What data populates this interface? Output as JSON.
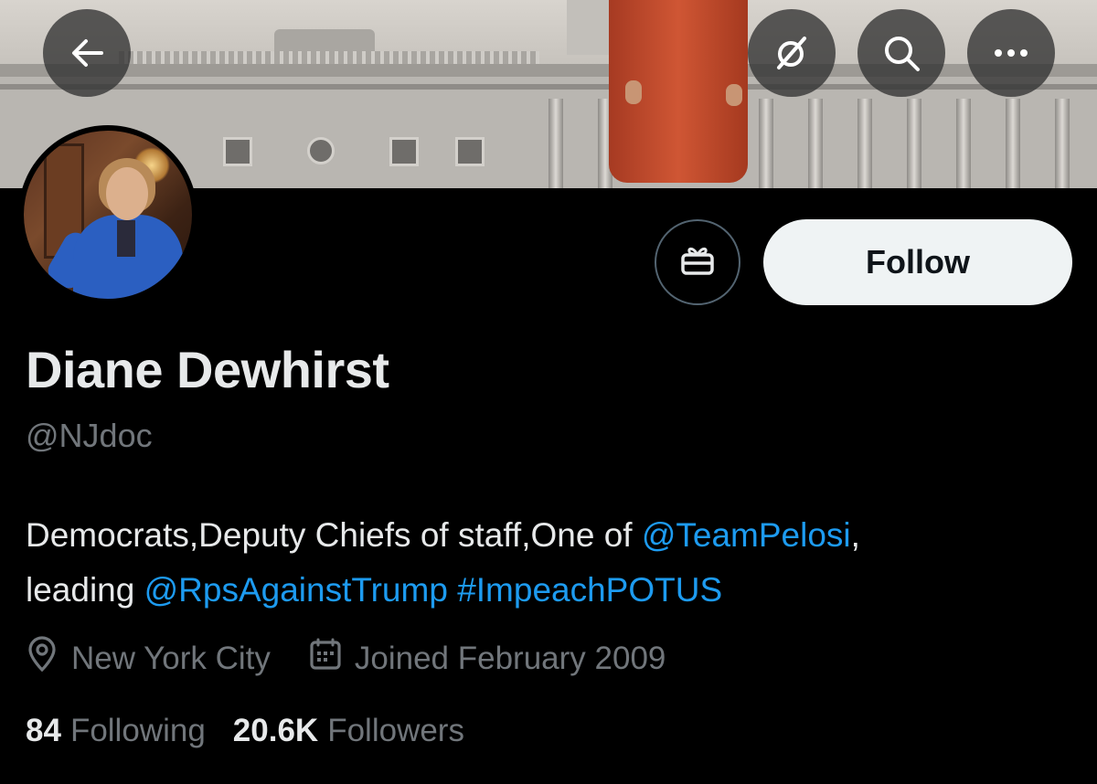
{
  "header": {
    "back_icon": "arrow-left-icon",
    "grok_icon": "grok-icon",
    "search_icon": "search-icon",
    "more_icon": "more-horizontal-icon"
  },
  "profile": {
    "name": "Diane Dewhirst",
    "handle": "@NJdoc",
    "bio": {
      "text_1": "Democrats,Deputy Chiefs of staff,One of ",
      "mention_1": "@TeamPelosi",
      "text_2": ",",
      "text_3": "leading ",
      "mention_2": "@RpsAgainstTrump",
      "text_4": " ",
      "hashtag": "#ImpeachPOTUS"
    },
    "location": "New York City",
    "joined": "Joined February 2009",
    "following_count": "84",
    "following_label": "Following",
    "followers_count": "20.6K",
    "followers_label": "Followers"
  },
  "actions": {
    "gift_icon": "gift-icon",
    "follow_label": "Follow"
  },
  "colors": {
    "background": "#000000",
    "text": "#e7e9ea",
    "muted": "#71767b",
    "link": "#1d9bf0",
    "follow_bg": "#eff3f4"
  }
}
